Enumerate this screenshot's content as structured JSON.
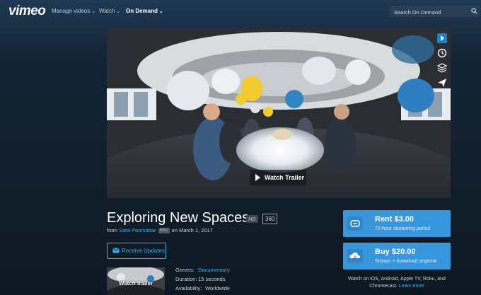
{
  "brand": {
    "logo": "vimeo"
  },
  "nav": {
    "items": [
      {
        "label": "Manage videos",
        "active": false
      },
      {
        "label": "Watch",
        "active": false
      },
      {
        "label": "On Demand",
        "active": true
      }
    ],
    "search_placeholder": "Search On Demand"
  },
  "player": {
    "trailer_label": "Watch Trailer",
    "tools": [
      "vimeo-icon",
      "clock-icon",
      "layers-icon",
      "send-icon"
    ]
  },
  "video": {
    "title": "Exploring New Spaces",
    "badges": {
      "hd": "HD",
      "vr": "360"
    },
    "by_prefix": "from",
    "author": "Sara Poorsattar",
    "author_badge": "PRO",
    "date": "on March 1, 2017"
  },
  "subscribe": {
    "label": "Receive Updates"
  },
  "thumbnail": {
    "label": "Watch trailer"
  },
  "details": {
    "genres_label": "Genres:",
    "genres_value": "Documentary",
    "duration_label": "Duration:",
    "duration_value": "15 seconds",
    "availability_label": "Availability:",
    "availability_value": "Worldwide"
  },
  "purchase": {
    "rent": {
      "price": "Rent $3.00",
      "sub": "72-hour streaming period"
    },
    "buy": {
      "price": "Buy $20.00",
      "sub": "Stream + download anytime"
    },
    "note": "Watch on iOS, Android, Apple TV, Roku, and Chromecast.",
    "learn_more": "Learn more"
  },
  "colors": {
    "accent": "#3cb0f0",
    "button": "#3796dc",
    "bg": "#0e1822"
  }
}
